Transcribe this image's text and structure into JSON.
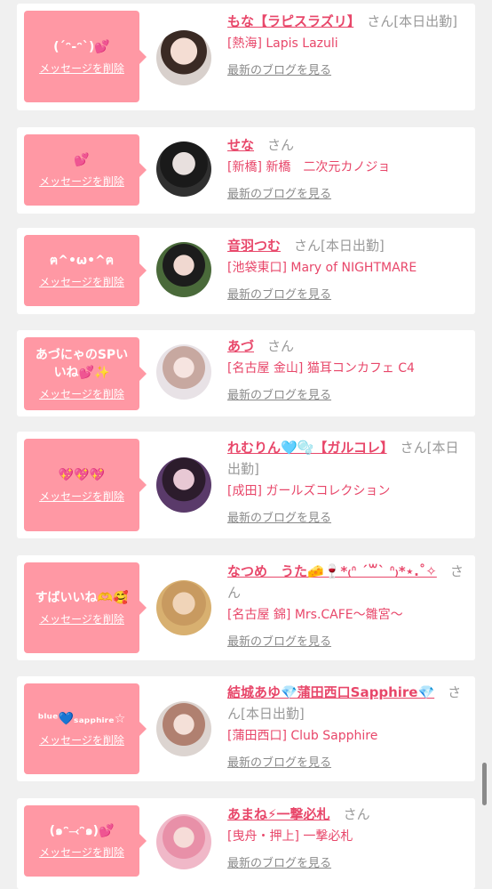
{
  "delete_label": "メッセージを削除",
  "blog_label": "最新のブログを見る",
  "san_label": "さん",
  "colors": {
    "accent": "#e8476a",
    "bubble": "#ff98a4",
    "link_gray": "#8a8a8a"
  },
  "items": [
    {
      "message": "(´ᵔ-ᵔ`)💕",
      "name": "もな【ラピスラズリ】",
      "status": "[本日出勤]",
      "shop": "[熱海] Lapis Lazuli"
    },
    {
      "message": "💕",
      "name": "せな",
      "status": "",
      "shop": "[新橋] 新橋　二次元カノジョ"
    },
    {
      "message": "ฅ^•ω•^ฅ",
      "name": "音羽つむ",
      "status": "[本日出勤]",
      "shop": "[池袋東口] Mary of NIGHTMARE"
    },
    {
      "message": "あづにゃのSPいいね💕✨",
      "name": "あづ",
      "status": "",
      "shop": "[名古屋 金山] 猫耳コンカフェ C4"
    },
    {
      "message": "💖💖💖",
      "name": "れむりん🩵🫧【ガルコレ】",
      "status": "[本日出勤]",
      "shop": "[成田] ガールズコレクション"
    },
    {
      "message": "すばいいね🫶🥰",
      "name": "なつめ　うた🧀🍷*₍ᐢ ˊ꒳ˋ ᐢ₎*⋆.˚✧",
      "status": "",
      "shop": "[名古屋 錦] Mrs.CAFE〜雛宮〜"
    },
    {
      "message": "ᵇˡᵘᵉ💙ₛₐₚₚₕᵢᵣₑ☆",
      "name": "結城あゆ💎蒲田西口Sapphire💎",
      "status": "[本日出勤]",
      "shop": "[蒲田西口] Club Sapphire"
    },
    {
      "message": "(๑ᵔ⤙ᵔ๑)💕",
      "name": "あまね⚡一撃必札",
      "status": "",
      "shop": "[曳舟・押上] 一撃必札"
    }
  ]
}
